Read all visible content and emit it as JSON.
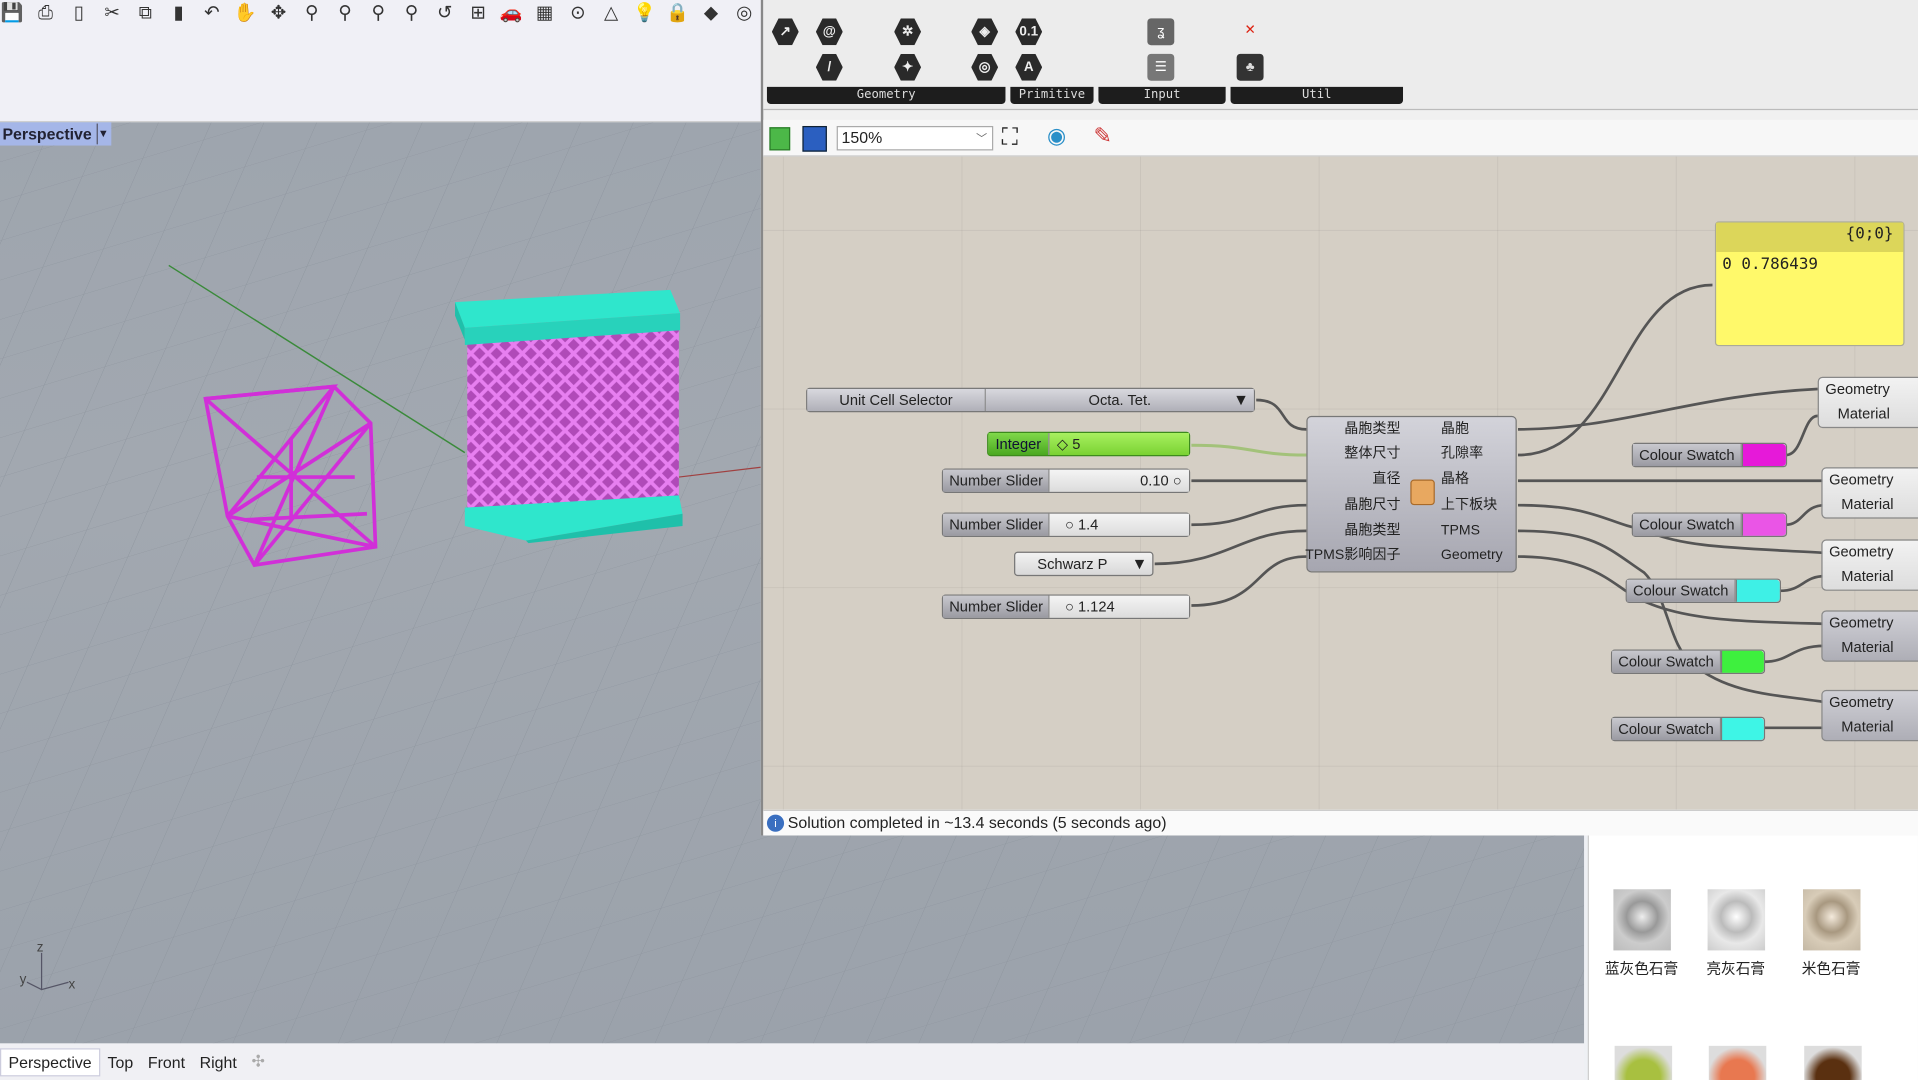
{
  "rhino": {
    "toolbar_icons": [
      "save-icon",
      "print-icon",
      "new-icon",
      "cut-icon",
      "copy-icon",
      "paste-icon",
      "undo-icon",
      "pan-icon",
      "rotate-icon",
      "zoom-icon",
      "zoom-window-icon",
      "zoom-extents-icon",
      "zoom-selected-icon",
      "undo-view-icon",
      "viewport-layout-icon",
      "car-icon",
      "grid-icon",
      "point-icon",
      "shapes-icon",
      "light-icon",
      "lock-icon",
      "material-icon",
      "color-wheel-icon"
    ],
    "viewport_label": "Perspective",
    "viewport_tabs": [
      "Perspective",
      "Top",
      "Front",
      "Right"
    ],
    "axes": {
      "z": "z",
      "y": "y",
      "x": "x"
    },
    "materials": [
      {
        "name": "蓝灰色石膏",
        "color": "#8a9090"
      },
      {
        "name": "亮灰石膏",
        "color": "#c8c8c8"
      },
      {
        "name": "米色石膏",
        "color": "#c8b89e"
      }
    ],
    "materials_row2_colors": [
      "#a8c040",
      "#e87850",
      "#5a3010"
    ],
    "lattice_color": "#d83fdc",
    "plate_color": "#33e0c8"
  },
  "grasshopper": {
    "ribbon_groups": [
      "Geometry",
      "Primitive",
      "Input",
      "Util"
    ],
    "zoom_level": "150%",
    "status": "Solution completed in ~13.4 seconds (5 seconds ago)",
    "nodes": {
      "unit_cell_selector": {
        "label": "Unit Cell Selector",
        "value": "Octa. Tet."
      },
      "integer": {
        "label": "Integer",
        "value": "5"
      },
      "slider1": {
        "label": "Number Slider",
        "value": "0.10"
      },
      "slider2": {
        "label": "Number Slider",
        "value": "1.4"
      },
      "tpms_select": {
        "value": "Schwarz P"
      },
      "slider3": {
        "label": "Number Slider",
        "value": "1.124"
      }
    },
    "component": {
      "inputs": [
        "晶胞类型",
        "整体尺寸",
        "直径",
        "晶胞尺寸",
        "晶胞类型",
        "TPMS影响因子"
      ],
      "outputs": [
        "晶胞",
        "孔隙率",
        "晶格",
        "上下板块",
        "TPMS",
        "Geometry"
      ]
    },
    "panel": {
      "path": "{0;0}",
      "index": "0",
      "value": "0.786439"
    },
    "swatches": [
      {
        "label": "Colour Swatch",
        "color": "#e619d9"
      },
      {
        "label": "Colour Swatch",
        "color": "#ea55e6"
      },
      {
        "label": "Colour Swatch",
        "color": "#3ef0e6"
      },
      {
        "label": "Colour Swatch",
        "color": "#3ef03e"
      },
      {
        "label": "Colour Swatch",
        "color": "#3ef5e6"
      }
    ],
    "preview": {
      "geometry": "Geometry",
      "material": "Material"
    }
  }
}
